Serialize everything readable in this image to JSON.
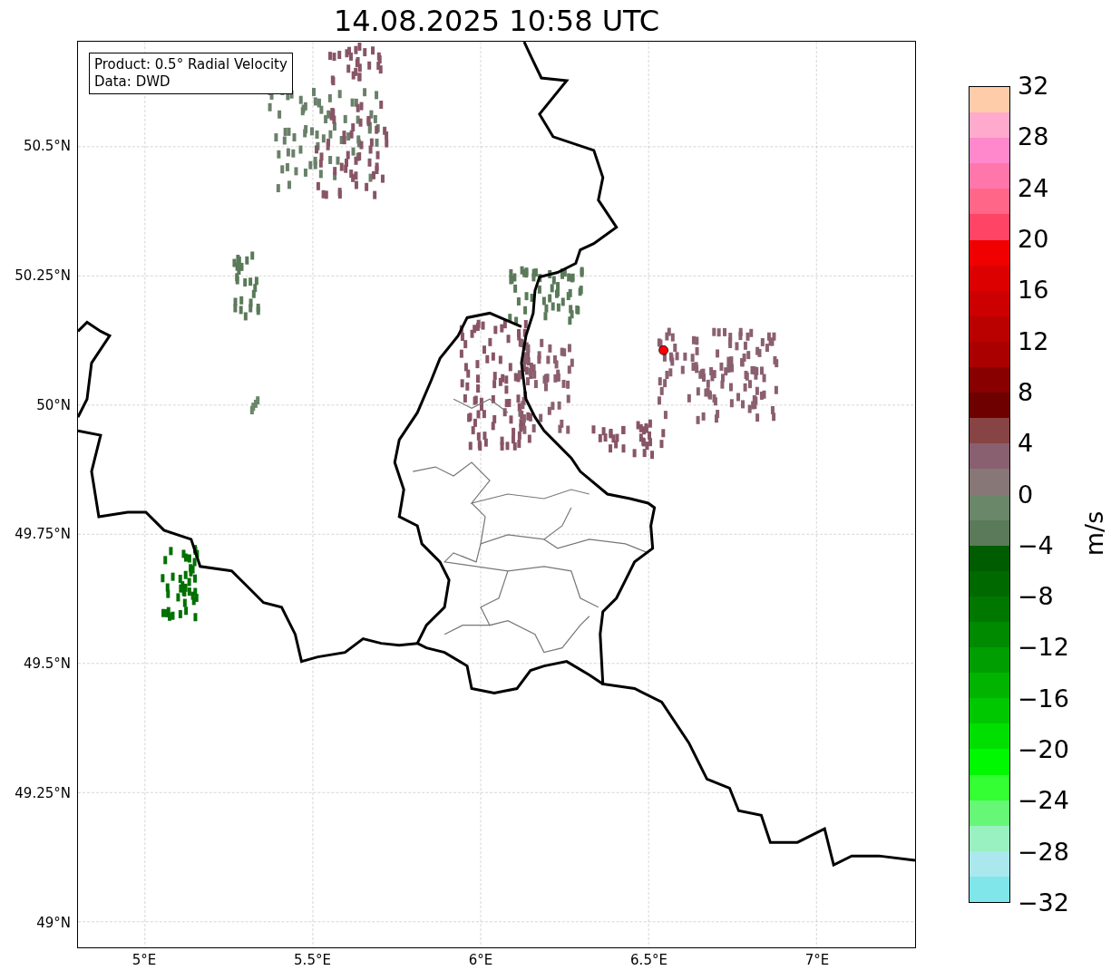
{
  "title": "14.08.2025 10:58 UTC",
  "legend": {
    "lines": [
      "Product: 0.5° Radial Velocity",
      "Data: DWD"
    ]
  },
  "map": {
    "lat_labels": [
      "50.5°N",
      "50.25°N",
      "50°N",
      "49.75°N",
      "49.5°N",
      "49.25°N",
      "49°N"
    ],
    "lon_labels": [
      "5°E",
      "5.5°E",
      "6°E",
      "6.5°E",
      "7°E"
    ]
  },
  "colorbar": {
    "label": "m/s",
    "ticks": [
      "32",
      "28",
      "24",
      "20",
      "16",
      "12",
      "8",
      "4",
      "0",
      "−4",
      "−8",
      "−12",
      "−16",
      "−20",
      "−24",
      "−28",
      "−32"
    ],
    "segments": [
      {
        "color": "#ffccaa"
      },
      {
        "color": "#ffaacc"
      },
      {
        "color": "#ff88cc"
      },
      {
        "color": "#ff77aa"
      },
      {
        "color": "#ff6688"
      },
      {
        "color": "#ff4466"
      },
      {
        "color": "#f00000"
      },
      {
        "color": "#dd0000"
      },
      {
        "color": "#cc0000"
      },
      {
        "color": "#bb0000"
      },
      {
        "color": "#aa0000"
      },
      {
        "color": "#880000"
      },
      {
        "color": "#6e0000"
      },
      {
        "color": "#884444"
      },
      {
        "color": "#886070"
      },
      {
        "color": "#887777"
      },
      {
        "color": "#6a876a"
      },
      {
        "color": "#5a7a5a"
      },
      {
        "color": "#005c00"
      },
      {
        "color": "#006a00"
      },
      {
        "color": "#007800"
      },
      {
        "color": "#008a00"
      },
      {
        "color": "#009e00"
      },
      {
        "color": "#00b400"
      },
      {
        "color": "#00c800"
      },
      {
        "color": "#00e000"
      },
      {
        "color": "#00f800"
      },
      {
        "color": "#33ff33"
      },
      {
        "color": "#66f777"
      },
      {
        "color": "#99f0c0"
      },
      {
        "color": "#aae8ee"
      },
      {
        "color": "#80e6ea"
      }
    ]
  }
}
